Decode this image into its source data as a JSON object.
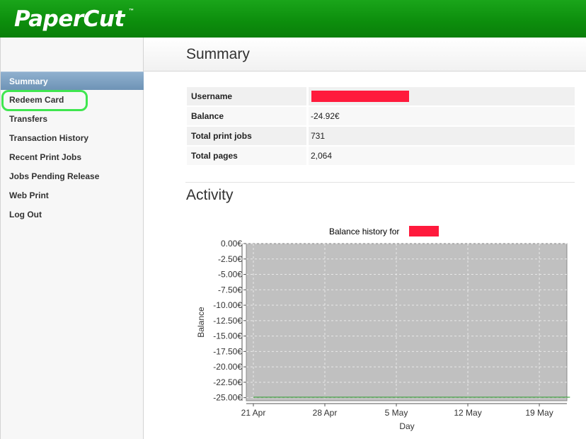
{
  "header": {
    "logo_text": "PaperCut",
    "logo_tm": "™"
  },
  "sidebar": {
    "items": [
      {
        "label": "Summary",
        "active": true
      },
      {
        "label": "Redeem Card",
        "active": false
      },
      {
        "label": "Transfers",
        "active": false
      },
      {
        "label": "Transaction History",
        "active": false
      },
      {
        "label": "Recent Print Jobs",
        "active": false
      },
      {
        "label": "Jobs Pending Release",
        "active": false
      },
      {
        "label": "Web Print",
        "active": false
      },
      {
        "label": "Log Out",
        "active": false
      }
    ]
  },
  "page": {
    "title": "Summary",
    "activity_title": "Activity"
  },
  "summary": {
    "rows": [
      {
        "label": "Username",
        "value": ""
      },
      {
        "label": "Balance",
        "value": "-24.92€"
      },
      {
        "label": "Total print jobs",
        "value": "731"
      },
      {
        "label": "Total pages",
        "value": "2,064"
      }
    ]
  },
  "colors": {
    "header_green": "#0c8d0c",
    "active_nav": "#7a9ec0",
    "redaction": "#ff1a3c",
    "highlight": "#3fe64f",
    "plot_bg": "#c0c0c0",
    "series_line": "#1a8f1a"
  },
  "chart_data": {
    "type": "line",
    "title": "Balance history for",
    "xlabel": "Day",
    "ylabel": "Balance",
    "x_ticks": [
      "21 Apr",
      "28 Apr",
      "5 May",
      "12 May",
      "19 May"
    ],
    "y_ticks": [
      "0.00€",
      "-2.50€",
      "-5.00€",
      "-7.50€",
      "-10.00€",
      "-12.50€",
      "-15.00€",
      "-17.50€",
      "-20.00€",
      "-22.50€",
      "-25.00€"
    ],
    "ylim": [
      -25.5,
      0
    ],
    "grid": true,
    "series": [
      {
        "x": [
          "2012-04-21",
          "2012-05-22"
        ],
        "values": [
          -24.92,
          -24.92
        ]
      }
    ]
  }
}
